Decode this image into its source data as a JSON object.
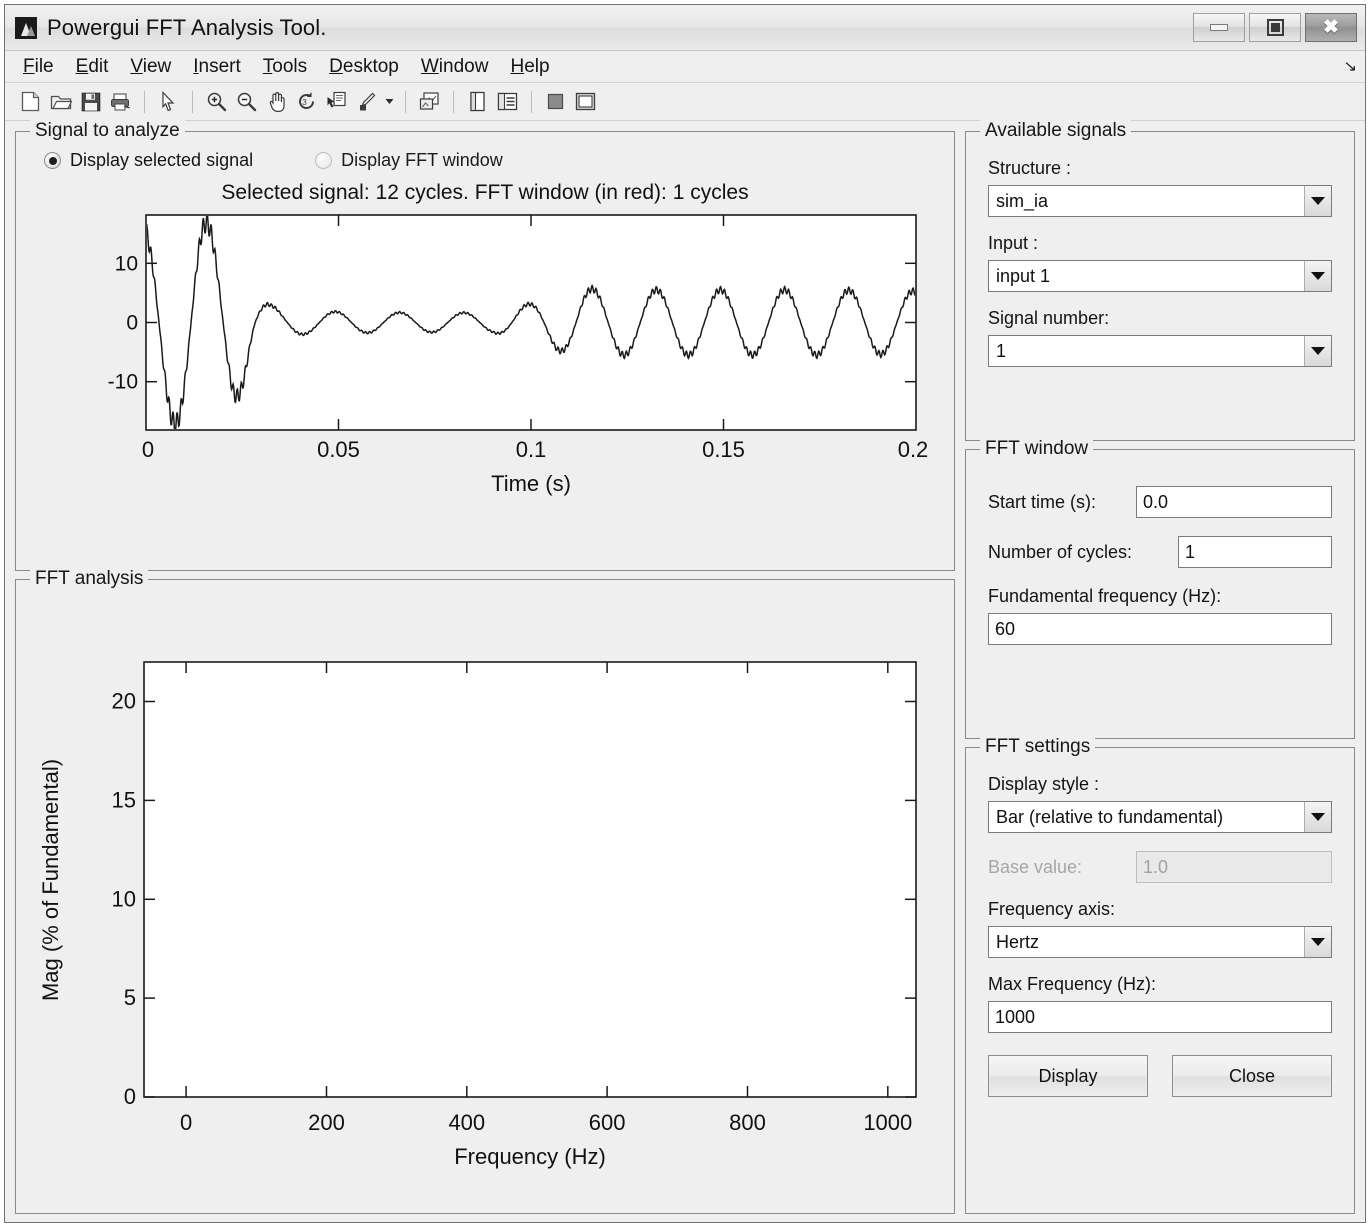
{
  "window": {
    "title": "Powergui FFT Analysis Tool.",
    "icon": "matlab-figure-icon",
    "buttons": {
      "minimize": "minimize",
      "maximize": "maximize",
      "close": "close"
    }
  },
  "menubar": {
    "items": [
      "File",
      "Edit",
      "View",
      "Insert",
      "Tools",
      "Desktop",
      "Window",
      "Help"
    ],
    "overflow": "↘"
  },
  "toolbar": {
    "items": [
      "new-figure-icon",
      "open-file-icon",
      "save-figure-icon",
      "print-figure-icon",
      "sep",
      "pointer-icon",
      "sep",
      "zoom-in-icon",
      "zoom-out-icon",
      "pan-icon",
      "rotate-3d-icon",
      "data-cursor-icon",
      "brush-icon",
      "brush-dropdown-icon",
      "sep",
      "link-plot-icon",
      "sep",
      "figure-palette-icon",
      "plot-browser-icon",
      "sep",
      "property-editor-icon",
      "docking-icon"
    ]
  },
  "signal_panel": {
    "title": "Signal to analyze",
    "radios": [
      {
        "label": "Display selected signal",
        "selected": true
      },
      {
        "label": "Display FFT window",
        "selected": false
      }
    ],
    "plot_title": "Selected signal: 12 cycles. FFT window (in red): 1 cycles"
  },
  "fft_panel": {
    "title": "FFT analysis"
  },
  "available_signals": {
    "title": "Available signals",
    "structure_label": "Structure :",
    "structure_value": "sim_ia",
    "input_label": "Input :",
    "input_value": "input 1",
    "signal_number_label": "Signal number:",
    "signal_number_value": "1"
  },
  "fft_window": {
    "title": "FFT window",
    "start_time_label": "Start time (s):",
    "start_time_value": "0.0",
    "cycles_label": "Number of cycles:",
    "cycles_value": "1",
    "fundamental_label": "Fundamental frequency (Hz):",
    "fundamental_value": "60"
  },
  "fft_settings": {
    "title": "FFT settings",
    "display_style_label": "Display style :",
    "display_style_value": "Bar (relative to fundamental)",
    "base_value_label": "Base value:",
    "base_value_value": "1.0",
    "base_value_enabled": false,
    "frequency_axis_label": "Frequency axis:",
    "frequency_axis_value": "Hertz",
    "max_frequency_label": "Max Frequency (Hz):",
    "max_frequency_value": "1000",
    "display_button": "Display",
    "close_button": "Close"
  },
  "colors": {
    "panel_bg": "#efefef",
    "plot_bg": "#ffffff",
    "trace": "#1a1a1a",
    "axis": "#1a1a1a",
    "border": "#8a8a8a"
  },
  "chart_data": [
    {
      "id": "signal-time-plot",
      "type": "line",
      "title": "Selected signal: 12 cycles. FFT window (in red): 1 cycles",
      "xlabel": "Time (s)",
      "ylabel": "",
      "xticks": [
        0,
        0.05,
        0.1,
        0.15,
        0.2
      ],
      "xticklabels": [
        "0",
        "0.05",
        "0.1",
        "0.15",
        "0.2"
      ],
      "yticks": [
        -10,
        0,
        10
      ],
      "yticklabels": [
        "-10",
        "0",
        "10"
      ],
      "xlim": [
        0,
        0.2
      ],
      "ylim": [
        -16.5,
        16.5
      ],
      "grid": false,
      "legend": null,
      "description": "Damped oscillatory current waveform: large transient for first ~0.03 s decaying to a small ripple, then growing back to a steady ~60 Hz sinusoid of amplitude ~5 after t=0.1 s",
      "series": [
        {
          "name": "sim_ia input 1",
          "color": "#1a1a1a",
          "envelope_points": [
            {
              "t": 0.0,
              "y": 14.5
            },
            {
              "t": 0.003,
              "y": 15.0
            },
            {
              "t": 0.0135,
              "y": -16.3
            },
            {
              "t": 0.018,
              "y": 14.3
            },
            {
              "t": 0.0225,
              "y": -12.8
            },
            {
              "t": 0.0255,
              "y": 9.6
            },
            {
              "t": 0.029,
              "y": -4.0
            },
            {
              "t": 0.0325,
              "y": 2.6
            },
            {
              "t": 0.036,
              "y": -2.0
            },
            {
              "t": 0.044,
              "y": 1.7
            },
            {
              "t": 0.055,
              "y": 1.6
            },
            {
              "t": 0.07,
              "y": 1.5
            },
            {
              "t": 0.09,
              "y": 1.5
            },
            {
              "t": 0.1005,
              "y": -3.0
            },
            {
              "t": 0.1065,
              "y": 4.2
            },
            {
              "t": 0.113,
              "y": 5.2
            },
            {
              "t": 0.125,
              "y": 5.0
            },
            {
              "t": 0.15,
              "y": 5.0
            },
            {
              "t": 0.175,
              "y": 5.0
            },
            {
              "t": 0.2,
              "y": 4.8
            }
          ]
        }
      ]
    },
    {
      "id": "fft-magnitude-plot",
      "type": "bar",
      "title": "",
      "xlabel": "Frequency (Hz)",
      "ylabel": "Mag (% of Fundamental)",
      "xticks": [
        0,
        200,
        400,
        600,
        800,
        1000
      ],
      "xticklabels": [
        "0",
        "200",
        "400",
        "600",
        "800",
        "1000"
      ],
      "yticks": [
        0,
        5,
        10,
        15,
        20
      ],
      "yticklabels": [
        "0",
        "5",
        "10",
        "15",
        "20"
      ],
      "xlim": [
        -60,
        1040
      ],
      "ylim": [
        0,
        22
      ],
      "grid": false,
      "legend": null,
      "categories": [],
      "values": [],
      "description": "Empty FFT magnitude axes; no spectrum has been computed yet"
    }
  ]
}
